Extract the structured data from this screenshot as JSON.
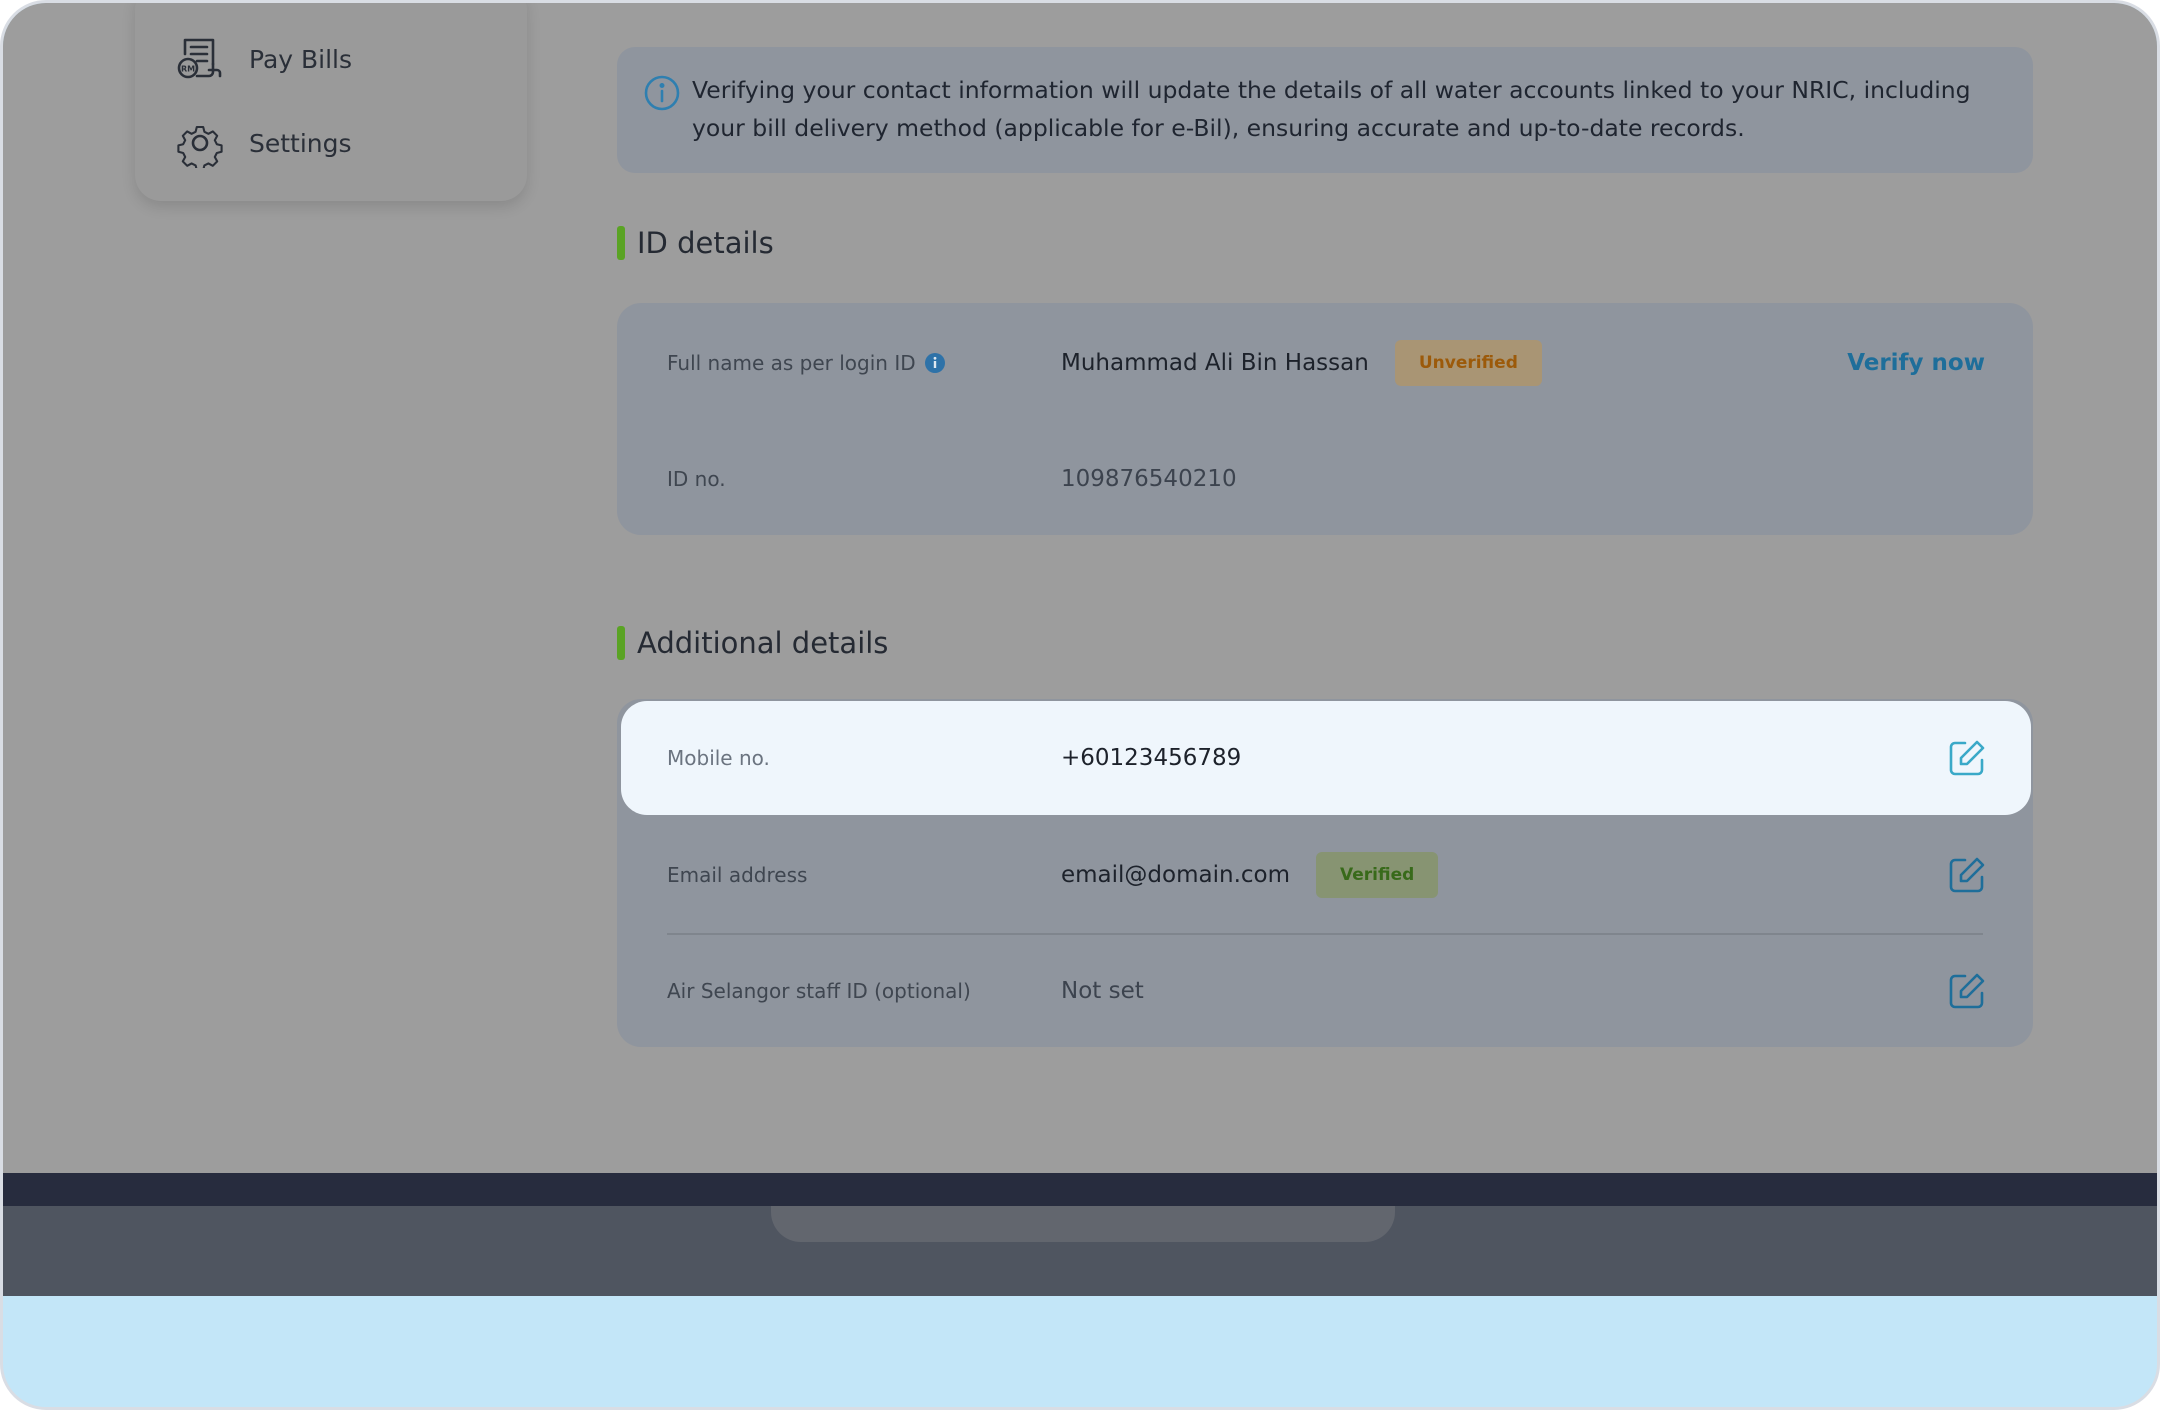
{
  "sidebar": {
    "items": [
      {
        "label": "Pay Bills",
        "icon": "bill-receipt-icon"
      },
      {
        "label": "Settings",
        "icon": "gear-icon"
      }
    ]
  },
  "notice": {
    "text": "Verifying your contact information will update the details of all water accounts linked to your NRIC, including your bill delivery method (applicable for e-Bil), ensuring accurate and up-to-date records."
  },
  "id_details": {
    "title": "ID details",
    "full_name_label": "Full name as per login ID",
    "full_name_value": "Muhammad Ali Bin Hassan",
    "full_name_status": "Unverified",
    "verify_link": "Verify now",
    "id_label": "ID no.",
    "id_value": "109876540210"
  },
  "additional_details": {
    "title": "Additional details",
    "mobile_label": "Mobile no.",
    "mobile_value": "+60123456789",
    "email_label": "Email address",
    "email_value": "email@domain.com",
    "email_status": "Verified",
    "staff_label": "Air Selangor staff ID (optional)",
    "staff_value": "Not set"
  },
  "colors": {
    "accent_green": "#5aa324",
    "link_blue": "#1e6e9a",
    "highlight_bg": "#eff6fc",
    "icon_teal": "#3aa9c8"
  }
}
